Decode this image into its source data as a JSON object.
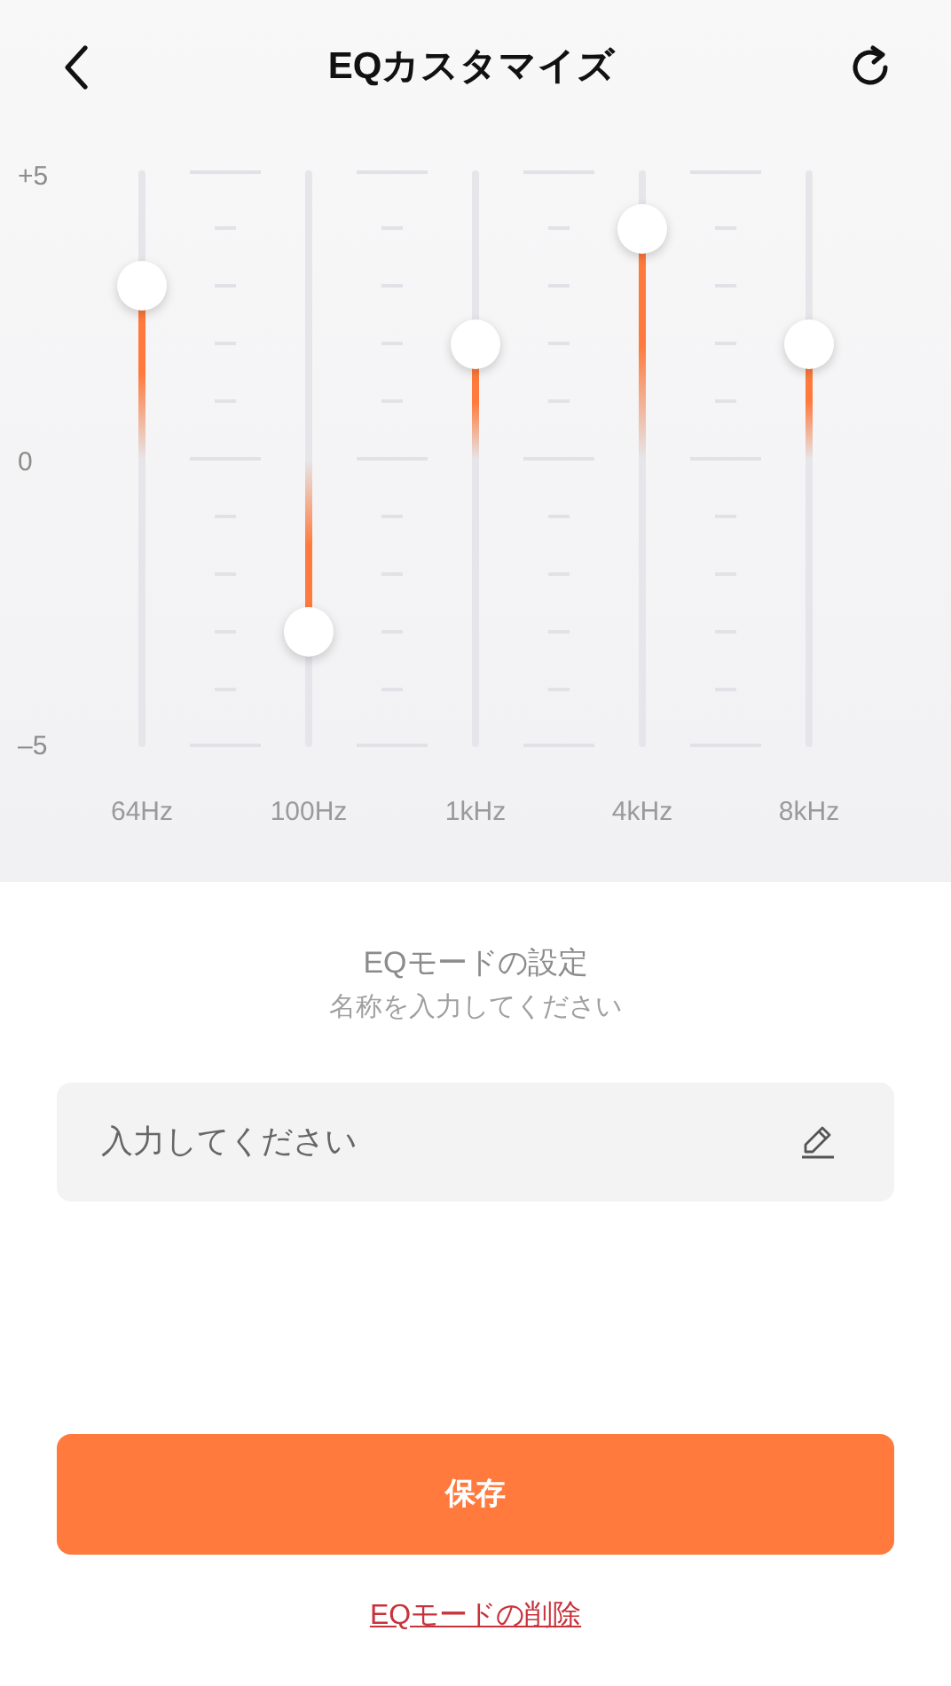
{
  "header": {
    "title": "EQカスタマイズ"
  },
  "eq": {
    "scale_labels": [
      "+5",
      "0",
      "–5"
    ],
    "bands": [
      {
        "label": "64Hz",
        "level": 0.8
      },
      {
        "label": "100Hz",
        "level": 0.2
      },
      {
        "label": "1kHz",
        "level": 0.7
      },
      {
        "label": "4kHz",
        "level": 0.9
      },
      {
        "label": "8kHz",
        "level": 0.7
      }
    ]
  },
  "mode_settings": {
    "title": "EQモードの設定",
    "subtitle": "名称を入力してください",
    "name_field": {
      "placeholder": "入力してください"
    }
  },
  "save_button": "保存",
  "delete_link": "EQモードの削除"
}
